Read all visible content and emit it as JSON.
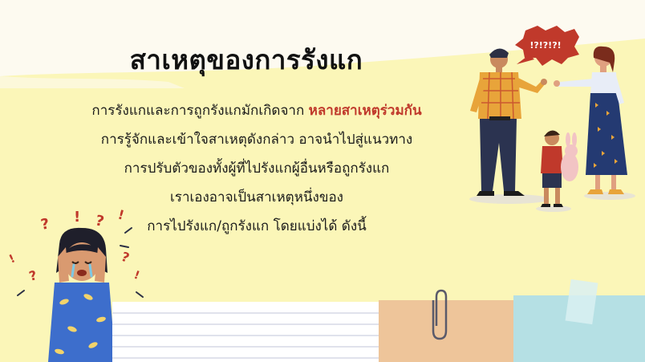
{
  "slide": {
    "title": "สาเหตุของการรังแก",
    "lines": [
      {
        "text": "การรังแกและการถูกรังแกมักเกิดจาก ",
        "highlight": "หลายสาเหตุร่วมกัน"
      },
      {
        "text": "การรู้จักและเข้าใจสาเหตุดังกล่าว อาจนำไปสู่แนวทาง"
      },
      {
        "text": "การปรับตัวของทั้งผู้ที่ไปรังแกผู้อื่นหรือถูกรังแก"
      },
      {
        "text": "เราเองอาจเป็นสาเหตุหนึ่งของ"
      },
      {
        "text": "การไปรังแก/ถูกรังแก โดยแบ่งได้ ดังนี้"
      }
    ],
    "speech_bubble": "!?!?!?!",
    "colors": {
      "highlight": "#c0392b",
      "background_yellow": "#fbf6b8"
    }
  }
}
